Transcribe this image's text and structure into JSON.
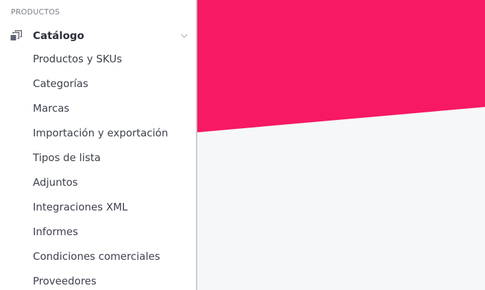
{
  "sidebar": {
    "section_title": "PRODUCTOS",
    "group": {
      "label": "Catálogo",
      "icon": "catalog-icon",
      "expanded": true,
      "items": [
        {
          "label": "Productos y SKUs"
        },
        {
          "label": "Categorías"
        },
        {
          "label": "Marcas"
        },
        {
          "label": "Importación y exportación"
        },
        {
          "label": "Tipos de lista"
        },
        {
          "label": "Adjuntos"
        },
        {
          "label": "Integraciones XML"
        },
        {
          "label": "Informes"
        },
        {
          "label": "Condiciones comerciales"
        },
        {
          "label": "Proveedores"
        }
      ]
    }
  },
  "colors": {
    "accent": "#f71963",
    "main_background": "#f6f7f9",
    "sidebar_text": "#3d414c",
    "section_title": "#7b7f8a"
  }
}
